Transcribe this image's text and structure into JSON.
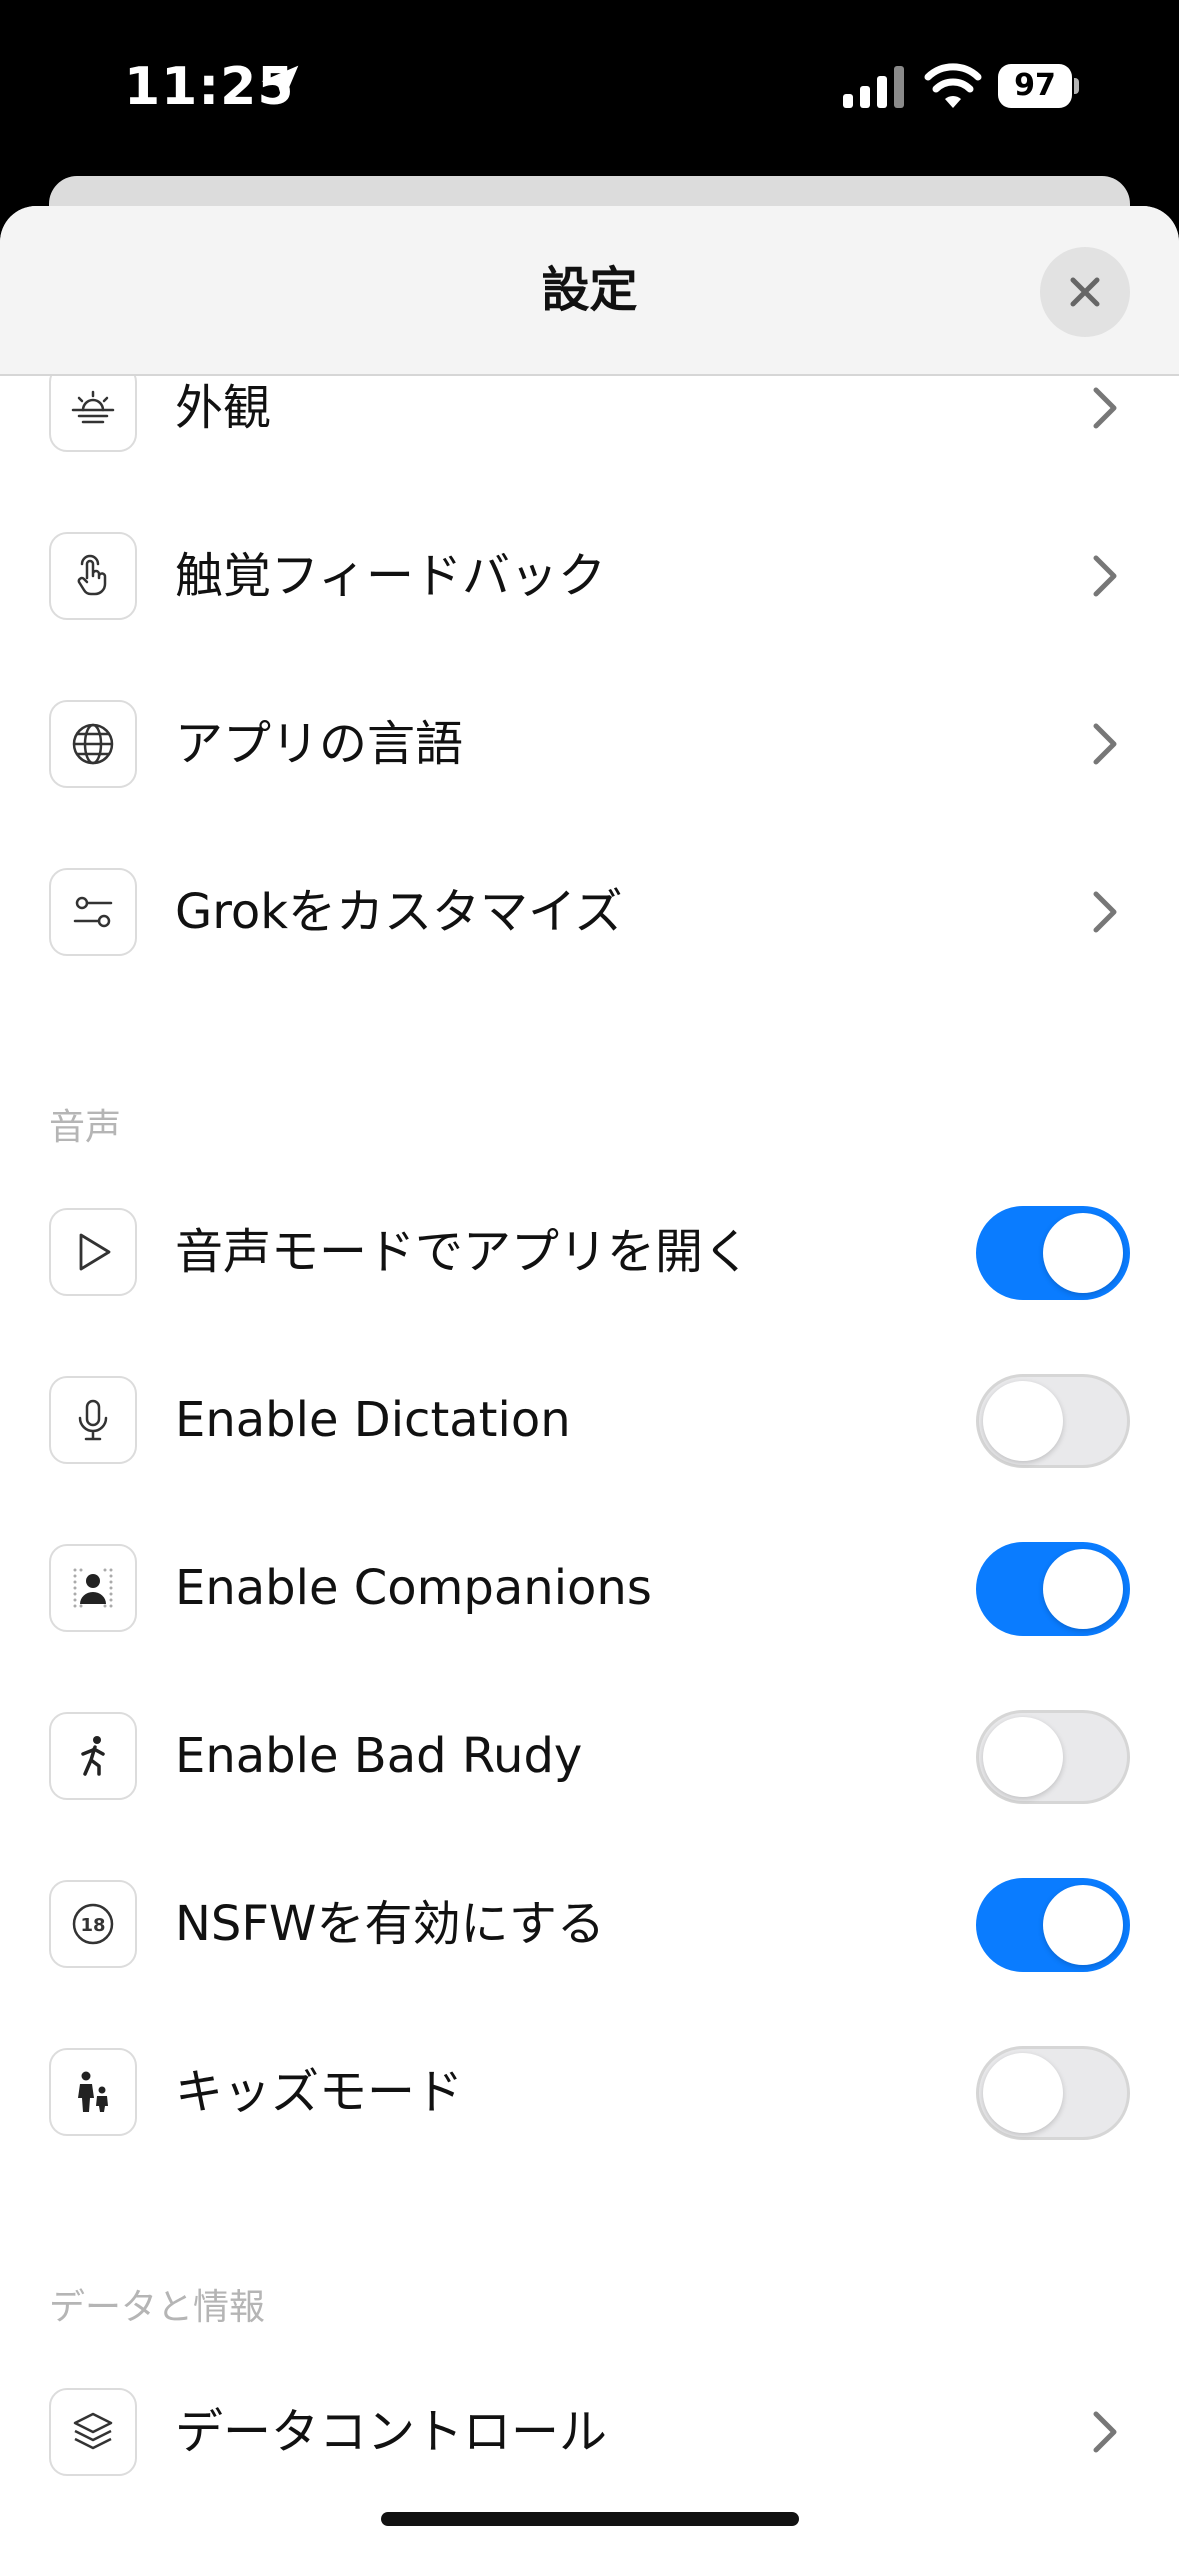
{
  "status_bar": {
    "time": "11:25",
    "battery": "97"
  },
  "sheet": {
    "title": "設定"
  },
  "rows_general": [
    {
      "label": "外観",
      "icon": "sunrise-icon"
    },
    {
      "label": "触覚フィードバック",
      "icon": "hand-tap-icon"
    },
    {
      "label": "アプリの言語",
      "icon": "globe-icon"
    },
    {
      "label": "Grokをカスタマイズ",
      "icon": "sliders-icon"
    }
  ],
  "sections": {
    "voice": "音声",
    "data": "データと情報"
  },
  "rows_voice": [
    {
      "label": "音声モードでアプリを開く",
      "icon": "play-icon",
      "on": true
    },
    {
      "label": "Enable Dictation",
      "icon": "microphone-icon",
      "on": false
    },
    {
      "label": "Enable Companions",
      "icon": "companion-person-icon",
      "on": true
    },
    {
      "label": "Enable Bad Rudy",
      "icon": "running-person-icon",
      "on": false
    },
    {
      "label": "NSFWを有効にする",
      "icon": "age-18-icon",
      "on": true
    },
    {
      "label": "キッズモード",
      "icon": "parent-child-icon",
      "on": false
    }
  ],
  "rows_data": [
    {
      "label": "データコントロール",
      "icon": "layers-icon"
    }
  ],
  "colors": {
    "toggle_on": "#0a7cff",
    "toggle_off": "#e9e9eb",
    "section_header": "#b5b5b5"
  }
}
